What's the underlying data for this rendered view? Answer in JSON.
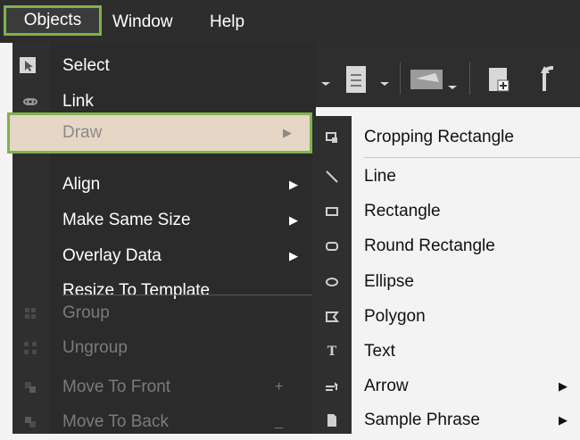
{
  "menubar": {
    "items": [
      {
        "label": "Objects"
      },
      {
        "label": "Window"
      },
      {
        "label": "Help"
      }
    ]
  },
  "objects_menu": {
    "items": [
      {
        "label": "Select",
        "icon": "pointer-icon",
        "enabled": true
      },
      {
        "label": "Link",
        "icon": "link-icon",
        "enabled": true
      },
      {
        "label": "Draw",
        "icon": "",
        "enabled": true,
        "submenu": true,
        "highlighted": true
      },
      {
        "label": "Align",
        "icon": "",
        "enabled": true,
        "submenu": true
      },
      {
        "label": "Make Same Size",
        "icon": "",
        "enabled": true,
        "submenu": true
      },
      {
        "label": "Overlay Data",
        "icon": "",
        "enabled": true,
        "submenu": true
      },
      {
        "label": "Resize To Template",
        "icon": "",
        "enabled": true
      },
      {
        "label": "Group",
        "icon": "group-icon",
        "enabled": false
      },
      {
        "label": "Ungroup",
        "icon": "ungroup-icon",
        "enabled": false
      },
      {
        "label": "Move To Front",
        "icon": "move-front-icon",
        "enabled": false,
        "shortcut": "+"
      },
      {
        "label": "Move To Back",
        "icon": "move-back-icon",
        "enabled": false,
        "shortcut": "_"
      }
    ]
  },
  "draw_submenu": {
    "items": [
      {
        "label": "Cropping Rectangle",
        "icon": "crop-icon"
      },
      {
        "label": "Line",
        "icon": "line-icon"
      },
      {
        "label": "Rectangle",
        "icon": "rectangle-icon"
      },
      {
        "label": "Round Rectangle",
        "icon": "round-rectangle-icon"
      },
      {
        "label": "Ellipse",
        "icon": "ellipse-icon"
      },
      {
        "label": "Polygon",
        "icon": "polygon-icon"
      },
      {
        "label": "Text",
        "icon": "text-icon"
      },
      {
        "label": "Arrow",
        "icon": "arrow-icon",
        "submenu": true
      },
      {
        "label": "Sample Phrase",
        "icon": "sample-phrase-icon",
        "submenu": true
      }
    ]
  },
  "colors": {
    "menubar_bg": "#2d2d2d",
    "highlight_border": "#7eb34a",
    "draw_highlight_bg": "#e6d6c6",
    "submenu_bg": "#f3f3f3"
  }
}
